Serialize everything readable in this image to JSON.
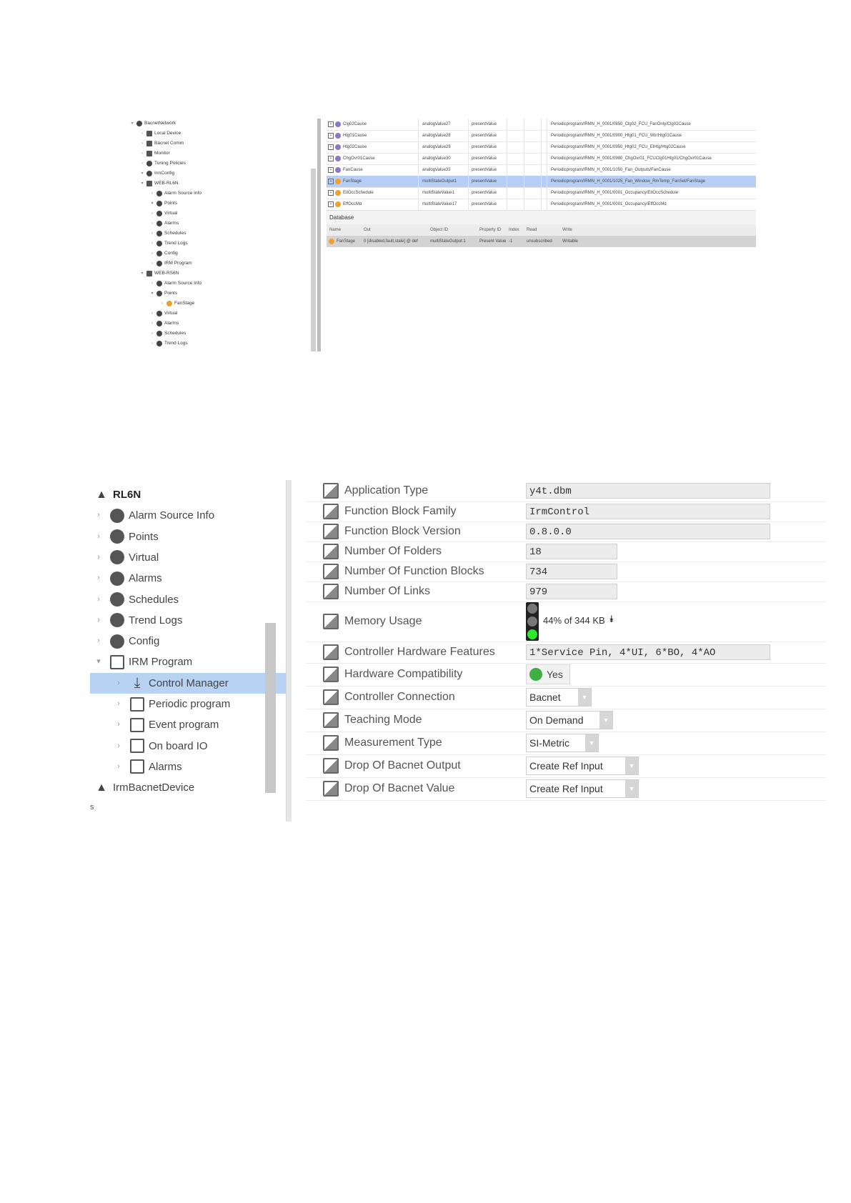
{
  "screen1": {
    "tree": [
      {
        "label": "BacnetNetwork",
        "depth": 0,
        "arrow": "▾",
        "icon": "network-icon"
      },
      {
        "label": "Local Device",
        "depth": 1,
        "arrow": "›",
        "icon": "device-icon"
      },
      {
        "label": "Bacnet Comm",
        "depth": 1,
        "arrow": "›",
        "icon": "comm-icon"
      },
      {
        "label": "Monitor",
        "depth": 1,
        "arrow": "›",
        "icon": "monitor-icon"
      },
      {
        "label": "Tuning Policies",
        "depth": 1,
        "arrow": "›",
        "icon": "tuning-icon"
      },
      {
        "label": "IrmConfig",
        "depth": 1,
        "arrow": "▾",
        "icon": "config-icon"
      },
      {
        "label": "WEB-RL6N",
        "depth": 1,
        "arrow": "▾",
        "icon": "controller-icon"
      },
      {
        "label": "Alarm Source Info",
        "depth": 2,
        "arrow": "›",
        "icon": "alarm-source-icon"
      },
      {
        "label": "Points",
        "depth": 2,
        "arrow": "▾",
        "icon": "points-icon"
      },
      {
        "label": "Virtual",
        "depth": 2,
        "arrow": "›",
        "icon": "virtual-icon"
      },
      {
        "label": "Alarms",
        "depth": 2,
        "arrow": "›",
        "icon": "alarms-icon"
      },
      {
        "label": "Schedules",
        "depth": 2,
        "arrow": "›",
        "icon": "schedules-icon"
      },
      {
        "label": "Trend Logs",
        "depth": 2,
        "arrow": "›",
        "icon": "trend-logs-icon"
      },
      {
        "label": "Config",
        "depth": 2,
        "arrow": "›",
        "icon": "config-icon"
      },
      {
        "label": "IRM Program",
        "depth": 2,
        "arrow": "›",
        "icon": "program-icon"
      },
      {
        "label": "WEB-RS6N",
        "depth": 1,
        "arrow": "▾",
        "icon": "controller-icon"
      },
      {
        "label": "Alarm Source Info",
        "depth": 2,
        "arrow": "›",
        "icon": "alarm-source-icon"
      },
      {
        "label": "Points",
        "depth": 2,
        "arrow": "▾",
        "icon": "points-icon"
      },
      {
        "label": "FanStage",
        "depth": 3,
        "arrow": "›",
        "icon": "point-orange-icon"
      },
      {
        "label": "Virtual",
        "depth": 2,
        "arrow": "›",
        "icon": "virtual-icon"
      },
      {
        "label": "Alarms",
        "depth": 2,
        "arrow": "›",
        "icon": "alarms-icon"
      },
      {
        "label": "Schedules",
        "depth": 2,
        "arrow": "›",
        "icon": "schedules-icon"
      },
      {
        "label": "Trend Logs",
        "depth": 2,
        "arrow": "›",
        "icon": "trend-logs-icon"
      }
    ],
    "grid": [
      {
        "name": "Clg02Cause",
        "object": "analogValue27",
        "property": "presentValue",
        "path": "Periodicprogram/IRMN_H_0001/0850_Clg02_FCU_FanOnly/Clg02Cause",
        "selected": false,
        "icon": "purple"
      },
      {
        "name": "Htg01Cause",
        "object": "analogValue28",
        "property": "presentValue",
        "path": "Periodicprogram/IRMN_H_0001/0900_Htg01_FCU_Wtr/Htg01Cause",
        "selected": false,
        "icon": "purple"
      },
      {
        "name": "Htg02Cause",
        "object": "analogValue29",
        "property": "presentValue",
        "path": "Periodicprogram/IRMN_H_0001/0950_Htg02_FCU_ElHtg/Htg02Cause",
        "selected": false,
        "icon": "purple"
      },
      {
        "name": "ChgOvr01Cause",
        "object": "analogValue30",
        "property": "presentValue",
        "path": "Periodicprogram/IRMN_H_0001/0980_ChgOvr01_FCUClg01Htg01/ChgOvr01Cause",
        "selected": false,
        "icon": "purple"
      },
      {
        "name": "FanCause",
        "object": "analogValue33",
        "property": "presentValue",
        "path": "Periodicprogram/IRMN_H_0001/1050_Fan_Outputs/FanCause",
        "selected": false,
        "icon": "purple"
      },
      {
        "name": "FanStage",
        "object": "multiStateOutput1",
        "property": "presentValue",
        "path": "Periodicprogram/IRMN_H_0001/1025_Fan_Window_RmTemp_FanSel/FanStage",
        "selected": true,
        "icon": "orange"
      },
      {
        "name": "EitOccSchedule",
        "object": "multiStateValue1",
        "property": "presentValue",
        "path": "Periodicprogram/IRMN_H_0001/0001_Occupancy/EitOccSchedule",
        "selected": false,
        "icon": "orange"
      },
      {
        "name": "EffOccMd",
        "object": "multiStateValue17",
        "property": "presentValue",
        "path": "Periodicprogram/IRMN_H_0001/0001_Occupancy/EffOccMd",
        "selected": false,
        "icon": "orange"
      }
    ],
    "database_tab": "Database",
    "db_headers": [
      "Name",
      "Out",
      "Object ID",
      "Property ID",
      "Index",
      "Read",
      "Write"
    ],
    "db_row": [
      "FanStage",
      "0 [disabled,fault,stale] @ def",
      "multiStateOutput:1",
      "Present Value",
      "-1",
      "unsubscribed",
      "Writable"
    ]
  },
  "screen2": {
    "tree": [
      {
        "label": "RL6N",
        "depth": 0,
        "arrow": "",
        "icon": "controller-icon",
        "selected": false,
        "bold": true
      },
      {
        "label": "Alarm Source Info",
        "depth": 1,
        "arrow": "›",
        "icon": "alarm-source-icon",
        "selected": false
      },
      {
        "label": "Points",
        "depth": 1,
        "arrow": "›",
        "icon": "points-icon",
        "selected": false
      },
      {
        "label": "Virtual",
        "depth": 1,
        "arrow": "›",
        "icon": "virtual-icon",
        "selected": false
      },
      {
        "label": "Alarms",
        "depth": 1,
        "arrow": "›",
        "icon": "alarms-icon",
        "selected": false
      },
      {
        "label": "Schedules",
        "depth": 1,
        "arrow": "›",
        "icon": "schedules-icon",
        "selected": false
      },
      {
        "label": "Trend Logs",
        "depth": 1,
        "arrow": "›",
        "icon": "trend-logs-icon",
        "selected": false
      },
      {
        "label": "Config",
        "depth": 1,
        "arrow": "›",
        "icon": "config-icon",
        "selected": false
      },
      {
        "label": "IRM Program",
        "depth": 1,
        "arrow": "▾",
        "icon": "program-icon",
        "selected": false
      },
      {
        "label": "Control Manager",
        "depth": 2,
        "arrow": "›",
        "icon": "download-icon",
        "selected": true
      },
      {
        "label": "Periodic program",
        "depth": 2,
        "arrow": "›",
        "icon": "program-folder-icon",
        "selected": false
      },
      {
        "label": "Event program",
        "depth": 2,
        "arrow": "›",
        "icon": "program-folder-icon",
        "selected": false
      },
      {
        "label": "On board IO",
        "depth": 2,
        "arrow": "›",
        "icon": "program-folder-icon",
        "selected": false
      },
      {
        "label": "Alarms",
        "depth": 2,
        "arrow": "›",
        "icon": "program-folder-icon",
        "selected": false
      },
      {
        "label": "IrmBacnetDevice",
        "depth": 0,
        "arrow": "",
        "icon": "controller-icon",
        "selected": false
      }
    ],
    "stray_char": "s",
    "properties": [
      {
        "label": "Application Type",
        "kind": "field",
        "value": "y4t.dbm",
        "width": "wide"
      },
      {
        "label": "Function Block Family",
        "kind": "field",
        "value": "IrmControl",
        "width": "wide"
      },
      {
        "label": "Function Block Version",
        "kind": "field",
        "value": "0.8.0.0",
        "width": "wide"
      },
      {
        "label": "Number Of Folders",
        "kind": "field",
        "value": "18",
        "width": "narrow"
      },
      {
        "label": "Number Of Function Blocks",
        "kind": "field",
        "value": "734",
        "width": "narrow"
      },
      {
        "label": "Number Of Links",
        "kind": "field",
        "value": "979",
        "width": "narrow"
      },
      {
        "label": "Memory Usage",
        "kind": "memory",
        "value": "44% of 344 KB"
      },
      {
        "label": "Controller Hardware Features",
        "kind": "field",
        "value": "1*Service Pin, 4*UI, 6*BO, 4*AO",
        "width": "wide"
      },
      {
        "label": "Hardware Compatibility",
        "kind": "yes",
        "value": "Yes"
      },
      {
        "label": "Controller Connection",
        "kind": "select",
        "value": "Bacnet",
        "width": "s1"
      },
      {
        "label": "Teaching Mode",
        "kind": "select",
        "value": "On Demand",
        "width": "s2"
      },
      {
        "label": "Measurement Type",
        "kind": "select",
        "value": "SI-Metric",
        "width": "s3"
      },
      {
        "label": "Drop Of Bacnet Output",
        "kind": "select",
        "value": "Create Ref Input",
        "width": "s4"
      },
      {
        "label": "Drop Of Bacnet Value",
        "kind": "select",
        "value": "Create Ref Input",
        "width": "s4"
      }
    ],
    "colors": {
      "selection": "#b7d2f3",
      "memory_green": "#2ee82e",
      "yes_green": "#3fae43"
    }
  }
}
